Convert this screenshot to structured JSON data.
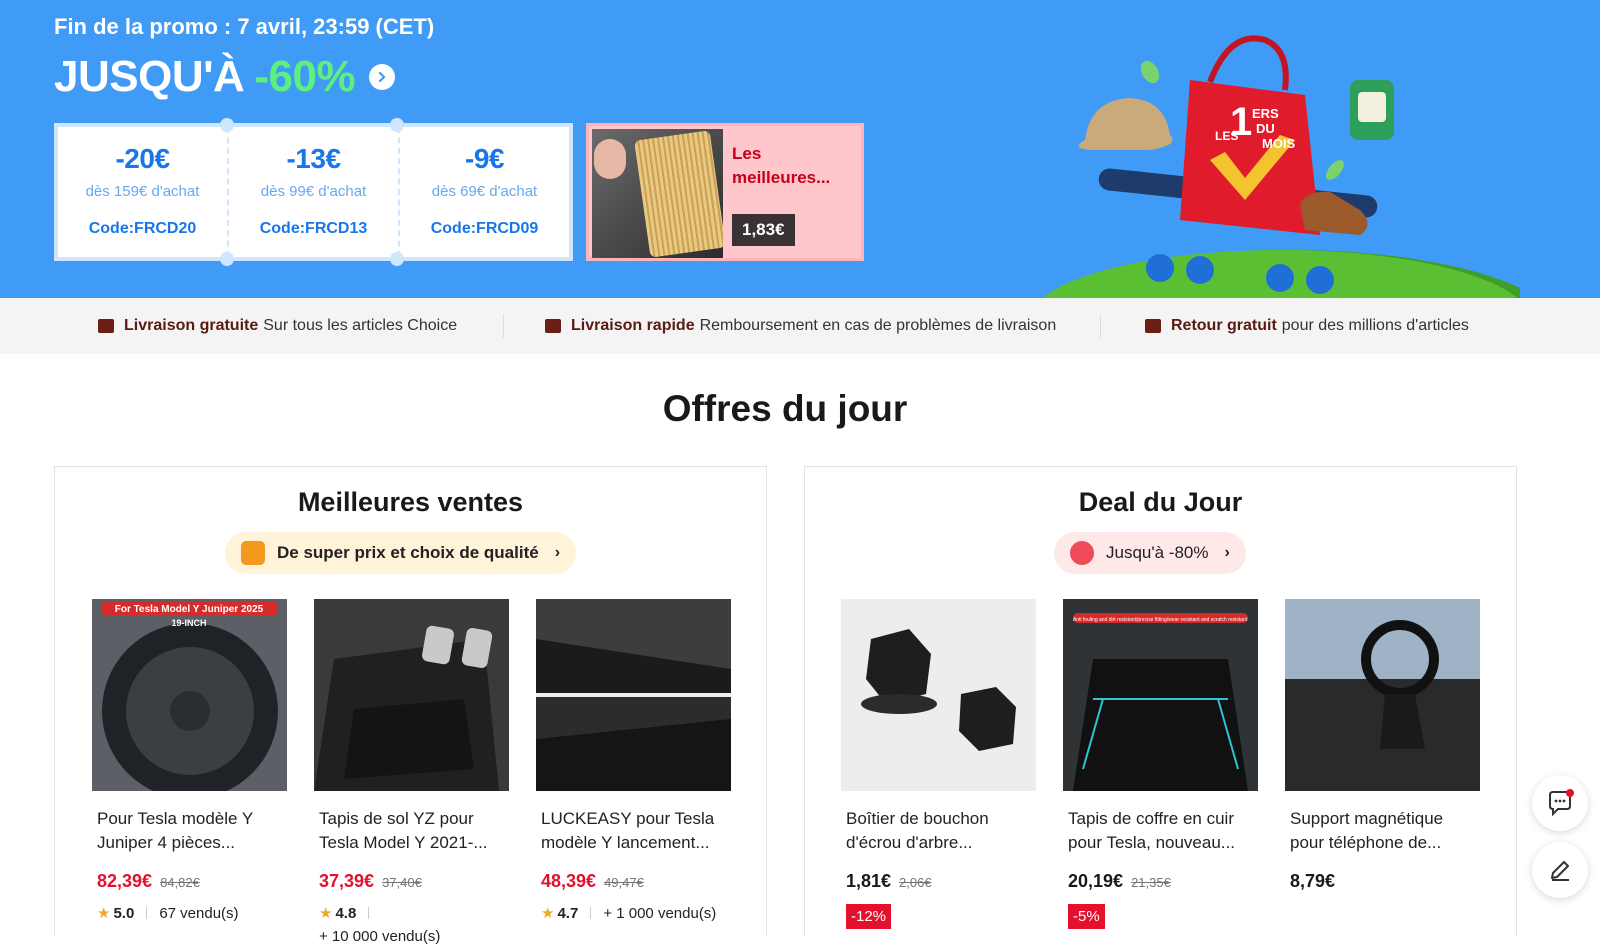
{
  "banner": {
    "promo_end": "Fin de la promo : 7 avril, 23:59 (CET)",
    "headline_prefix": "JUSQU'À",
    "headline_pct": "-60%",
    "coupons": [
      {
        "amount": "-20€",
        "condition": "dès 159€ d'achat",
        "code": "Code:FRCD20"
      },
      {
        "amount": "-13€",
        "condition": "dès 99€ d'achat",
        "code": "Code:FRCD13"
      },
      {
        "amount": "-9€",
        "condition": "dès 69€ d'achat",
        "code": "Code:FRCD09"
      }
    ],
    "best_card": {
      "label": "Les meilleures...",
      "price": "1,83€"
    },
    "hero_bag_text": [
      "1",
      "ERS",
      "DU",
      "LES",
      "MOIS"
    ],
    "colors": {
      "background": "#3f9bf5",
      "accent_green": "#5ef07e",
      "coupon_blue": "#1877e8"
    }
  },
  "benefits": [
    {
      "title": "Livraison gratuite",
      "text": "Sur tous les articles Choice",
      "icon": "free-shipping-truck-icon"
    },
    {
      "title": "Livraison rapide",
      "text": "Remboursement en cas de problèmes de livraison",
      "icon": "box-icon"
    },
    {
      "title": "Retour gratuit",
      "text": "pour des millions d'articles",
      "icon": "return-icon"
    }
  ],
  "offers": {
    "title": "Offres du jour",
    "best_sellers": {
      "title": "Meilleures ventes",
      "pill": "De super prix et choix de qualité",
      "products": [
        {
          "image_text": "For Tesla Model Y Juniper 2025",
          "image_subtext": "19-INCH",
          "name": "Pour Tesla modèle Y Juniper 4 pièces...",
          "price": "82,39€",
          "old_price": "84,82€",
          "rating": "5.0",
          "sold": "67 vendu(s)"
        },
        {
          "name": "Tapis de sol YZ pour Tesla Model Y 2021-...",
          "price": "37,39€",
          "old_price": "37,40€",
          "rating": "4.8",
          "sold": "+ 10 000 vendu(s)"
        },
        {
          "name": "LUCKEASY pour Tesla modèle Y lancement...",
          "price": "48,39€",
          "old_price": "49,47€",
          "rating": "4.7",
          "sold": "+ 1 000 vendu(s)"
        }
      ]
    },
    "deal_of_day": {
      "title": "Deal du Jour",
      "pill": "Jusqu'à -80%",
      "products": [
        {
          "name": "Boîtier de bouchon d'écrou d'arbre...",
          "price": "1,81€",
          "old_price": "2,06€",
          "discount": "-12%"
        },
        {
          "image_text": "Anti fouling and dirt resistant/precise fitting/wear-resistant and scratch resistant",
          "name": "Tapis de coffre en cuir pour Tesla, nouveau...",
          "price": "20,19€",
          "old_price": "21,35€",
          "discount": "-5%"
        },
        {
          "name": "Support magnétique pour téléphone de...",
          "price": "8,79€"
        }
      ]
    }
  },
  "floating": {
    "chat_icon": "chat-icon",
    "feedback_icon": "pencil-icon"
  }
}
